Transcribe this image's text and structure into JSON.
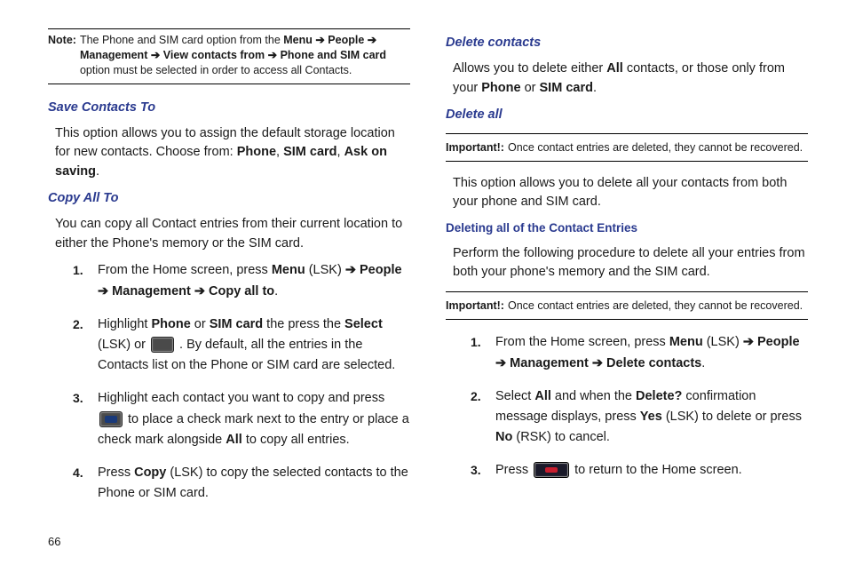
{
  "pageNumber": "66",
  "left": {
    "note": {
      "label": "Note:",
      "text_pre": "The Phone and SIM card option from the ",
      "path": "Menu ➔ People ➔ Management ➔ View contacts from ➔ Phone and SIM card",
      "text_post": " option must be selected in order to access all Contacts."
    },
    "saveContacts": {
      "heading": "Save Contacts To",
      "para_pre": "This option allows you to assign the default storage location for new contacts. Choose from: ",
      "opts": [
        "Phone",
        "SIM card",
        "Ask on saving"
      ],
      "para_post": "."
    },
    "copyAll": {
      "heading": "Copy All To",
      "para": "You can copy all Contact entries from their current location to either the Phone's memory or the SIM card.",
      "steps": [
        {
          "num": "1.",
          "t1": "From the Home screen, press ",
          "b1": "Menu",
          "t2": " (LSK) ",
          "arrow1": "➔",
          "b2": " People ",
          "arrow2": "➔",
          "b3": " Management ",
          "arrow3": " ➔ ",
          "b4": "Copy all to",
          "t3": "."
        },
        {
          "num": "2.",
          "t1": "Highlight ",
          "b1": "Phone",
          "t2": " or ",
          "b2": "SIM card",
          "t3": " the press the ",
          "b3": "Select",
          "t4": " (LSK) or ",
          "t5": " . By default, all the entries in the Contacts list on the Phone or SIM card are selected."
        },
        {
          "num": "3.",
          "t1": "Highlight each contact you want to copy and press ",
          "t2": " to place a check mark next to the entry or place a check mark alongside ",
          "b1": "All",
          "t3": " to copy all entries."
        },
        {
          "num": "4.",
          "t1": "Press ",
          "b1": "Copy",
          "t2": " (LSK) to copy the selected contacts to the Phone or SIM card."
        }
      ]
    }
  },
  "right": {
    "deleteContacts": {
      "heading": "Delete contacts",
      "para_t1": "Allows you to delete either ",
      "para_b1": "All",
      "para_t2": " contacts, or those only from your ",
      "para_b2": "Phone",
      "para_t3": " or ",
      "para_b3": "SIM card",
      "para_t4": "."
    },
    "deleteAll": {
      "heading": "Delete all",
      "important1_label": "Important!:",
      "important1_text": "Once contact entries are deleted, they cannot be recovered.",
      "para": "This option allows you to delete all your contacts from both your phone and SIM card."
    },
    "deletingAll": {
      "heading": "Deleting all of the Contact Entries",
      "para": "Perform the following procedure to delete all your entries from both your phone's memory and the SIM card.",
      "important2_label": "Important!:",
      "important2_text": "Once contact entries are deleted, they cannot be recovered.",
      "steps": [
        {
          "num": "1.",
          "t1": "From the Home screen, press ",
          "b1": "Menu",
          "t2": " (LSK) ",
          "arrow1": "➔",
          "b2": " People ",
          "arrow2": "➔",
          "b3": " Management ",
          "arrow3": " ➔ ",
          "b4": "Delete contacts",
          "t3": "."
        },
        {
          "num": "2.",
          "t1": "Select ",
          "b1": "All",
          "t2": " and when the ",
          "b2": "Delete?",
          "t3": " confirmation message displays, press ",
          "b3": "Yes",
          "t4": " (LSK) to delete or press ",
          "b4": "No",
          "t5": " (RSK) to cancel."
        },
        {
          "num": "3.",
          "t1": "Press ",
          "t2": " to return to the Home screen."
        }
      ]
    }
  }
}
